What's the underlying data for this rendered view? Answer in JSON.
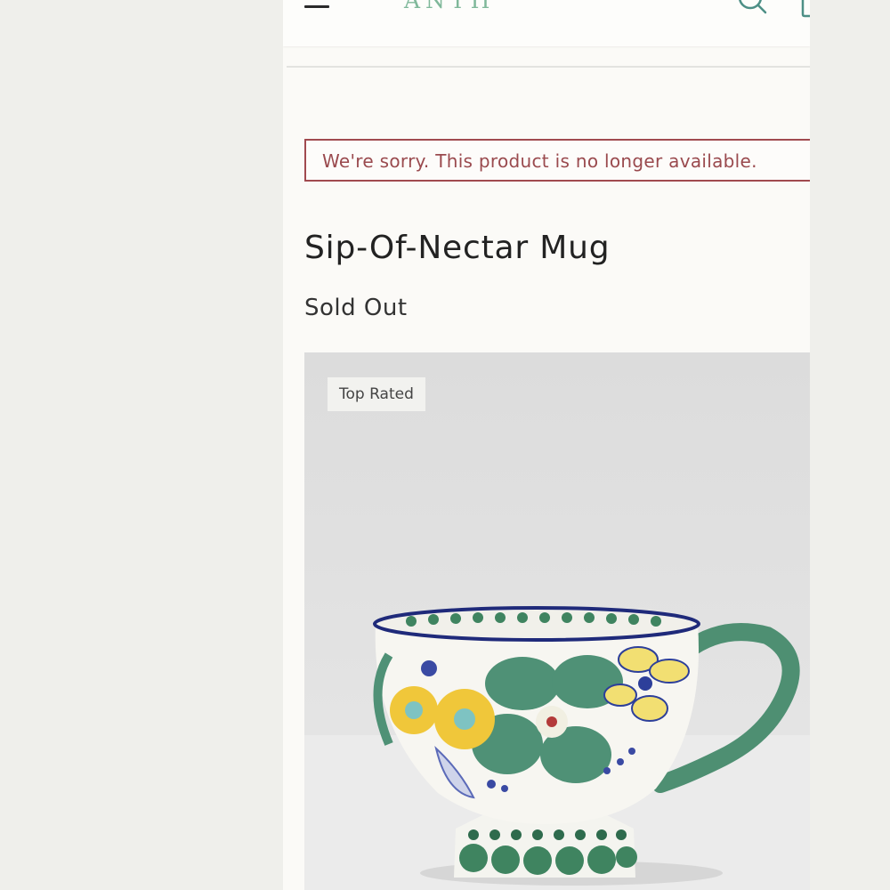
{
  "header": {
    "logo_text": "ANTH",
    "menu_icon": "hamburger-menu-icon",
    "search_icon": "search-icon",
    "bag_icon": "shopping-bag-icon"
  },
  "alert": {
    "message": "We're sorry. This product is no longer available.",
    "border_color": "#a14a4f",
    "text_color": "#9a4a4e"
  },
  "product": {
    "title": "Sip-Of-Nectar Mug",
    "status": "Sold Out",
    "badge": "Top Rated",
    "image_alt": "mug-image"
  }
}
